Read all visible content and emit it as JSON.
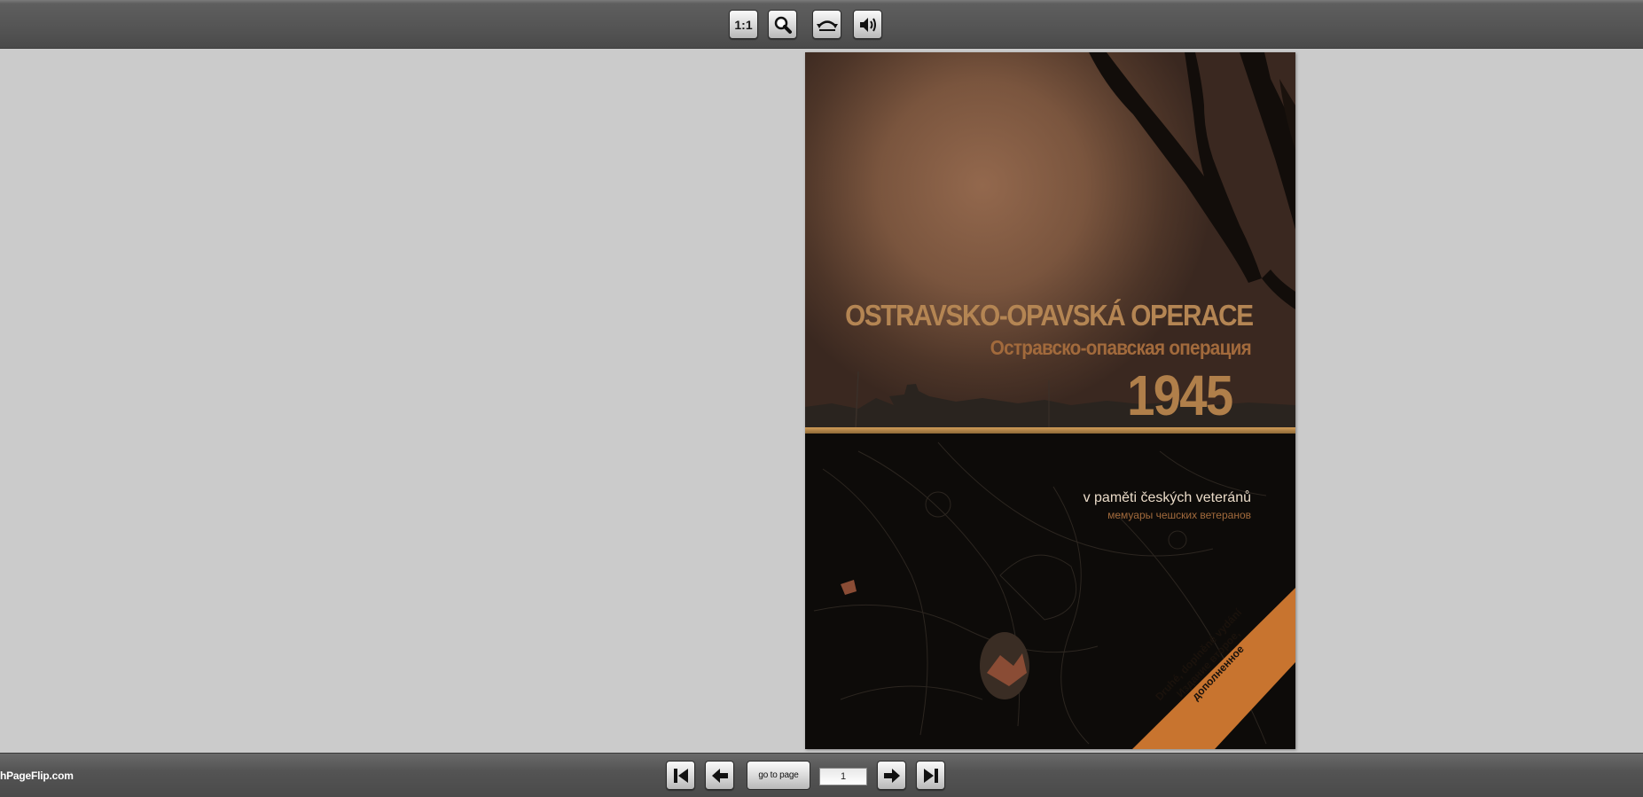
{
  "toolbar": {
    "actual_size_label": "1:1",
    "buttons": [
      "actual-size",
      "zoom",
      "flip",
      "sound"
    ]
  },
  "book": {
    "title_cs": "OSTRAVSKO-OPAVSKÁ OPERACE",
    "title_ru": "Остравско-опавская операция",
    "year": "1945",
    "subtitle_cs": "v paměti českých veteránů",
    "subtitle_ru": "мемуары чешских ветеранов",
    "ribbon_line1": "Druhé, doplněné vydání",
    "ribbon_line2": "Издание второе,",
    "ribbon_line3": "дополненное",
    "colors": {
      "title": "#b48553",
      "ribbon": "#c8742f",
      "gold_line": "#d09c58"
    }
  },
  "navigation": {
    "goto_label": "go to page",
    "page_value": "1"
  },
  "brand_text": "hPageFlip.com"
}
